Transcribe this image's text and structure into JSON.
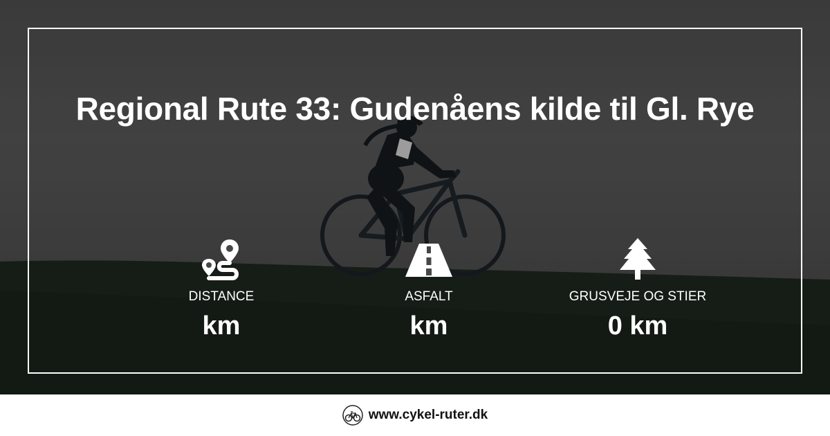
{
  "title": "Regional Rute 33: Gudenåens kilde til Gl. Rye",
  "stats": [
    {
      "icon": "route-icon",
      "label": "DISTANCE",
      "value": "km"
    },
    {
      "icon": "road-icon",
      "label": "ASFALT",
      "value": "km"
    },
    {
      "icon": "tree-icon",
      "label": "GRUSVEJE OG STIER",
      "value": "0 km"
    }
  ],
  "footer": {
    "site": "www.cykel-ruter.dk",
    "logo": "bicycle-logo-icon"
  }
}
